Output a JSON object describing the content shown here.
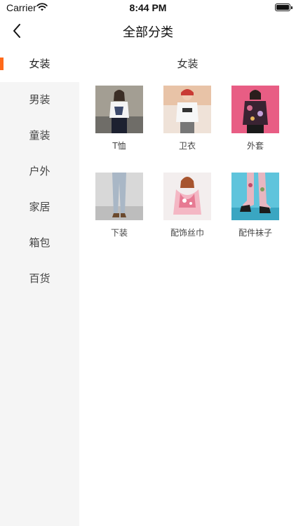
{
  "status_bar": {
    "carrier": "Carrier",
    "time": "8:44 PM"
  },
  "nav": {
    "title": "全部分类",
    "back_icon": "chevron-left-icon"
  },
  "sidebar": {
    "items": [
      {
        "label": "女装",
        "active": true
      },
      {
        "label": "男装"
      },
      {
        "label": "童装"
      },
      {
        "label": "户外"
      },
      {
        "label": "家居"
      },
      {
        "label": "箱包"
      },
      {
        "label": "百货"
      }
    ]
  },
  "content": {
    "section_title": "女装",
    "products": [
      {
        "label": "T恤"
      },
      {
        "label": "卫衣"
      },
      {
        "label": "外套"
      },
      {
        "label": "下装"
      },
      {
        "label": "配饰丝巾"
      },
      {
        "label": "配件袜子"
      }
    ]
  },
  "colors": {
    "accent": "#ff6a1a",
    "sidebar_bg": "#f5f5f5"
  }
}
